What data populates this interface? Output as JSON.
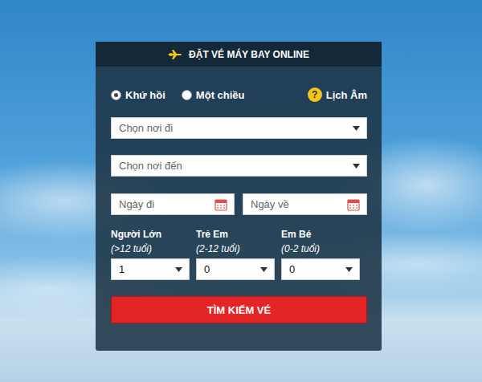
{
  "header": {
    "title": "ĐẶT VÉ MÁY BAY ONLINE"
  },
  "trip_types": [
    {
      "label": "Khứ hồi",
      "selected": true
    },
    {
      "label": "Một chiều",
      "selected": false
    }
  ],
  "lunar_calendar": {
    "icon": "?",
    "label": "Lịch Âm"
  },
  "origin": {
    "placeholder": "Chọn nơi đi"
  },
  "destination": {
    "placeholder": "Chọn nơi đến"
  },
  "dates": [
    {
      "placeholder": "Ngày đi"
    },
    {
      "placeholder": "Ngày về"
    }
  ],
  "passengers": [
    {
      "label": "Người Lớn",
      "age": "(>12 tuổi)",
      "value": "1"
    },
    {
      "label": "Trẻ Em",
      "age": "(2-12 tuổi)",
      "value": "0"
    },
    {
      "label": "Em Bé",
      "age": "(0-2 tuổi)",
      "value": "0"
    }
  ],
  "search_button": "TÌM KIẾM VÉ"
}
